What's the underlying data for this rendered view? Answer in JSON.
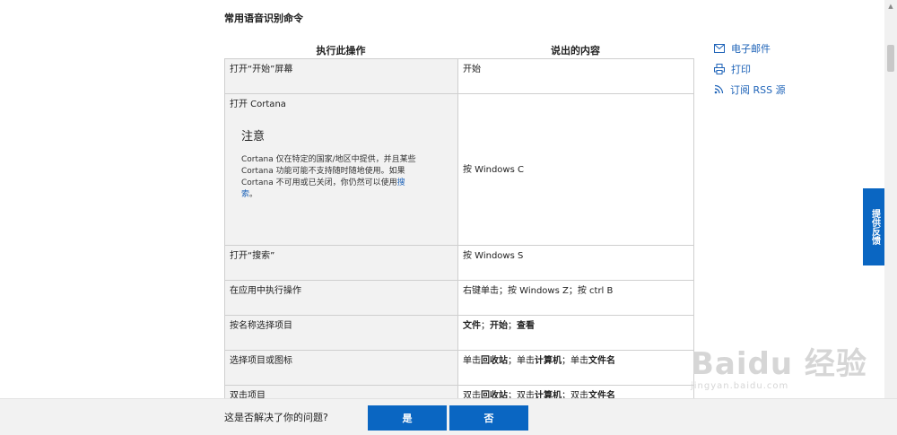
{
  "section_title": "常用语音识别命令",
  "table": {
    "col_action": "执行此操作",
    "col_say": "说出的内容",
    "rows": [
      {
        "action": "打开“开始”屏幕",
        "say": "开始"
      },
      {
        "action": "打开 Cortana",
        "say": "按 Windows C",
        "note_title": "注意",
        "note_text": "Cortana 仅在特定的国家/地区中提供，并且某些 Cortana 功能可能不支持随时随地使用。如果 Cortana 不可用或已关闭，你仍然可以使用",
        "note_link": "搜索",
        "note_end": "。"
      },
      {
        "action": "打开“搜索”",
        "say": "按 Windows S"
      },
      {
        "action": "在应用中执行操作",
        "say": "右键单击；按 Windows Z；按 ctrl B"
      },
      {
        "action": "按名称选择项目",
        "say_parts": [
          "文件",
          "；",
          "开始",
          "；",
          "查看"
        ]
      },
      {
        "action": "选择项目或图标",
        "say_parts": [
          "单击",
          "回收站",
          "；单击",
          "计算机",
          "；单击",
          "文件名"
        ]
      },
      {
        "action": "双击项目",
        "say_parts": [
          "双击",
          "回收站",
          "；双击",
          "计算机",
          "；双击",
          "文件名"
        ]
      }
    ]
  },
  "sidebar": {
    "email": "电子邮件",
    "print": "打印",
    "rss": "订阅 RSS 源"
  },
  "feedback_tab": "提供反馈",
  "bottom_bar": {
    "question": "这是否解决了你的问题?",
    "yes": "是",
    "no": "否"
  },
  "watermark": {
    "main": "Baidu 经验",
    "sub": "jingyan.baidu.com"
  },
  "colors": {
    "accent": "#0a66c2",
    "link": "#1e63b8",
    "action_cell_bg": "#f2f2f2"
  }
}
